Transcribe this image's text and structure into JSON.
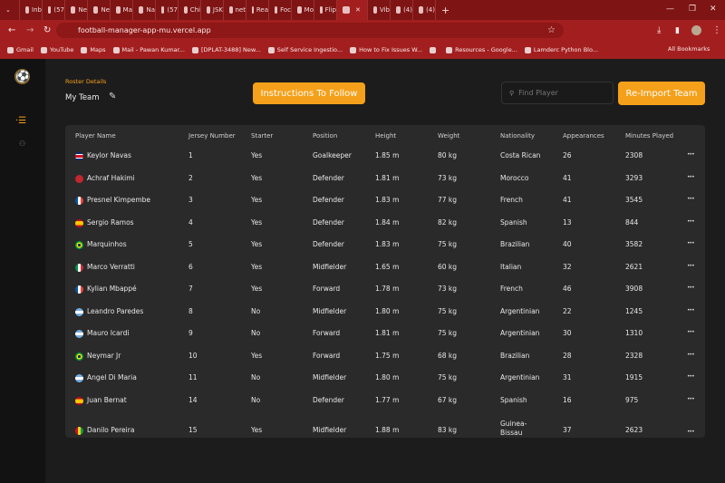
{
  "browser": {
    "tabs": [
      {
        "label": "Inb"
      },
      {
        "label": "(57"
      },
      {
        "label": "Ne"
      },
      {
        "label": "Ne"
      },
      {
        "label": "Ma"
      },
      {
        "label": "Na"
      },
      {
        "label": "(57"
      },
      {
        "label": "Chi"
      },
      {
        "label": "JSK"
      },
      {
        "label": "net"
      },
      {
        "label": "Rea"
      },
      {
        "label": "Foc"
      },
      {
        "label": "Mo"
      },
      {
        "label": "Flip"
      },
      {
        "label": "",
        "active": true
      },
      {
        "label": "Vib"
      },
      {
        "label": "(4)"
      },
      {
        "label": "(4)"
      }
    ],
    "url": "football-manager-app-mu.vercel.app",
    "bookmarks": [
      "Gmail",
      "YouTube",
      "Maps",
      "Mail - Pawan Kumar...",
      "[DPLAT-3488] New...",
      "Self Service Ingestio...",
      "How to Fix Issues W...",
      "",
      "Resources - Google...",
      "Lamderc Python Blo..."
    ],
    "all_bookmarks": "All Bookmarks"
  },
  "header": {
    "section_label": "Roster Details",
    "team_name": "My Team",
    "instructions_button": "Instructions To Follow",
    "search_placeholder": "Find Player",
    "reimport_button": "Re-Import Team"
  },
  "colors": {
    "accent": "#f5a01a",
    "background": "#1c1c1c",
    "table": "#2a2a2a",
    "browser": "#a31f1f"
  },
  "table": {
    "columns": [
      "Player Name",
      "Jersey Number",
      "Starter",
      "Position",
      "Height",
      "Weight",
      "Nationality",
      "Appearances",
      "Minutes Played"
    ],
    "rows": [
      {
        "flag": "costa-rica",
        "name": "Keylor Navas",
        "jersey": "1",
        "starter": "Yes",
        "position": "Goalkeeper",
        "height": "1.85 m",
        "weight": "80 kg",
        "nationality": "Costa Rican",
        "appearances": "26",
        "minutes": "2308"
      },
      {
        "flag": "morocco",
        "name": "Achraf Hakimi",
        "jersey": "2",
        "starter": "Yes",
        "position": "Defender",
        "height": "1.81 m",
        "weight": "73 kg",
        "nationality": "Morocco",
        "appearances": "41",
        "minutes": "3293"
      },
      {
        "flag": "france",
        "name": "Presnel Kimpembe",
        "jersey": "3",
        "starter": "Yes",
        "position": "Defender",
        "height": "1.83 m",
        "weight": "77 kg",
        "nationality": "French",
        "appearances": "41",
        "minutes": "3545"
      },
      {
        "flag": "spain",
        "name": "Sergio Ramos",
        "jersey": "4",
        "starter": "Yes",
        "position": "Defender",
        "height": "1.84 m",
        "weight": "82 kg",
        "nationality": "Spanish",
        "appearances": "13",
        "minutes": "844"
      },
      {
        "flag": "brazil",
        "name": "Marquinhos",
        "jersey": "5",
        "starter": "Yes",
        "position": "Defender",
        "height": "1.83 m",
        "weight": "75 kg",
        "nationality": "Brazilian",
        "appearances": "40",
        "minutes": "3582"
      },
      {
        "flag": "italy",
        "name": "Marco Verratti",
        "jersey": "6",
        "starter": "Yes",
        "position": "Midfielder",
        "height": "1.65 m",
        "weight": "60 kg",
        "nationality": "Italian",
        "appearances": "32",
        "minutes": "2621"
      },
      {
        "flag": "france",
        "name": "Kylian Mbappé",
        "jersey": "7",
        "starter": "Yes",
        "position": "Forward",
        "height": "1.78 m",
        "weight": "73 kg",
        "nationality": "French",
        "appearances": "46",
        "minutes": "3908"
      },
      {
        "flag": "argentina",
        "name": "Leandro Paredes",
        "jersey": "8",
        "starter": "No",
        "position": "Midfielder",
        "height": "1.80 m",
        "weight": "75 kg",
        "nationality": "Argentinian",
        "appearances": "22",
        "minutes": "1245"
      },
      {
        "flag": "argentina",
        "name": "Mauro Icardi",
        "jersey": "9",
        "starter": "No",
        "position": "Forward",
        "height": "1.81 m",
        "weight": "75 kg",
        "nationality": "Argentinian",
        "appearances": "30",
        "minutes": "1310"
      },
      {
        "flag": "brazil",
        "name": "Neymar Jr",
        "jersey": "10",
        "starter": "Yes",
        "position": "Forward",
        "height": "1.75 m",
        "weight": "68 kg",
        "nationality": "Brazilian",
        "appearances": "28",
        "minutes": "2328"
      },
      {
        "flag": "argentina",
        "name": "Angel Di Maria",
        "jersey": "11",
        "starter": "No",
        "position": "Midfielder",
        "height": "1.80 m",
        "weight": "75 kg",
        "nationality": "Argentinian",
        "appearances": "31",
        "minutes": "1915"
      },
      {
        "flag": "spain",
        "name": "Juan Bernat",
        "jersey": "14",
        "starter": "No",
        "position": "Defender",
        "height": "1.77 m",
        "weight": "67 kg",
        "nationality": "Spanish",
        "appearances": "16",
        "minutes": "975"
      },
      {
        "flag": "guinea-bissau",
        "name": "Danilo Pereira",
        "jersey": "15",
        "starter": "Yes",
        "position": "Midfielder",
        "height": "1.88 m",
        "weight": "83 kg",
        "nationality": "Guinea-Bissau",
        "appearances": "37",
        "minutes": "2623"
      }
    ]
  }
}
